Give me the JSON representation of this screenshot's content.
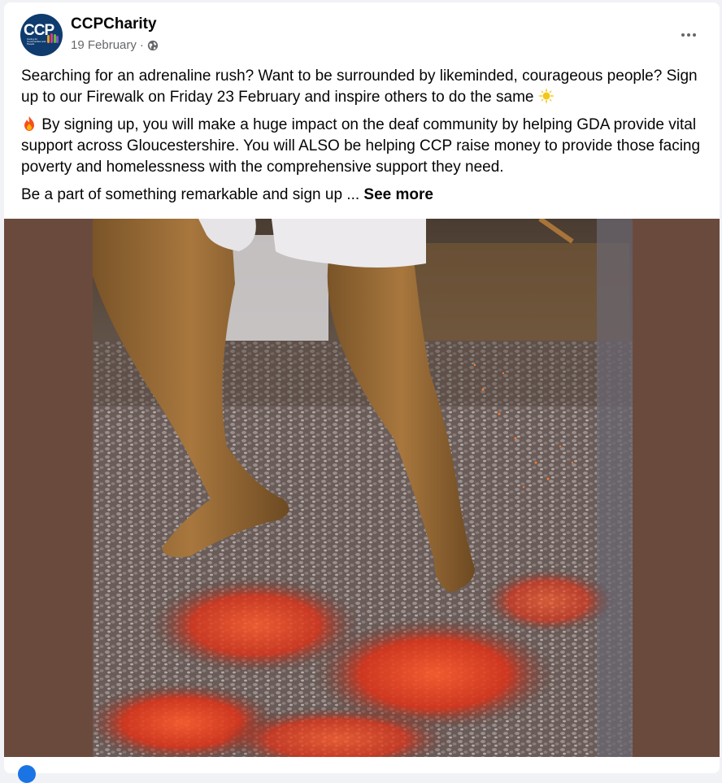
{
  "post": {
    "page_name": "CCPCharity",
    "date": "19 February",
    "separator": "·",
    "avatar": {
      "logo_text": "CCP",
      "tagline": "Caring for Communities and People"
    },
    "paragraphs": [
      {
        "text": "Searching for an adrenaline rush? Want to be surrounded by likeminded, courageous people? Sign up to our Firewalk on Friday 23 February and inspire others to do the same",
        "trailing_emoji": "sun-emoji"
      },
      {
        "leading_emoji": "fire-emoji",
        "text": "By signing up, you will make a huge impact on the deaf community by helping GDA provide vital support across Gloucestershire. You will ALSO be helping CCP raise money to provide those facing poverty and homelessness with the comprehensive support they need."
      },
      {
        "text": "Be a part of something remarkable and sign up ...",
        "see_more": "See more"
      }
    ],
    "image": {
      "subject": "firewalk-photo"
    }
  },
  "colors": {
    "media_background": "#6b4a3e",
    "text_primary": "#050505",
    "text_secondary": "#65676b",
    "avatar_bg": "#0f3b6e"
  },
  "icons": {
    "visibility": "globe-icon",
    "menu": "more-options-icon"
  }
}
